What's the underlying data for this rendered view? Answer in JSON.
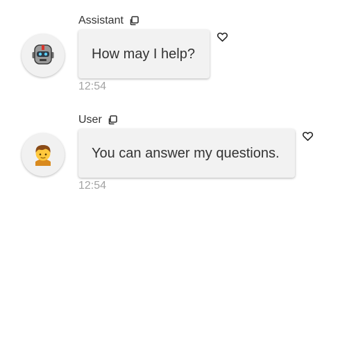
{
  "messages": [
    {
      "author": "Assistant",
      "text": "How may I help?",
      "time": "12:54",
      "avatar_icon": "robot-icon"
    },
    {
      "author": "User",
      "text": "You can answer my questions.",
      "time": "12:54",
      "avatar_icon": "person-icon"
    }
  ],
  "colors": {
    "bubble_bg": "#f2f2f2",
    "avatar_bg": "#f1f1f1",
    "text": "#333333",
    "timestamp": "#a3a3a3"
  }
}
